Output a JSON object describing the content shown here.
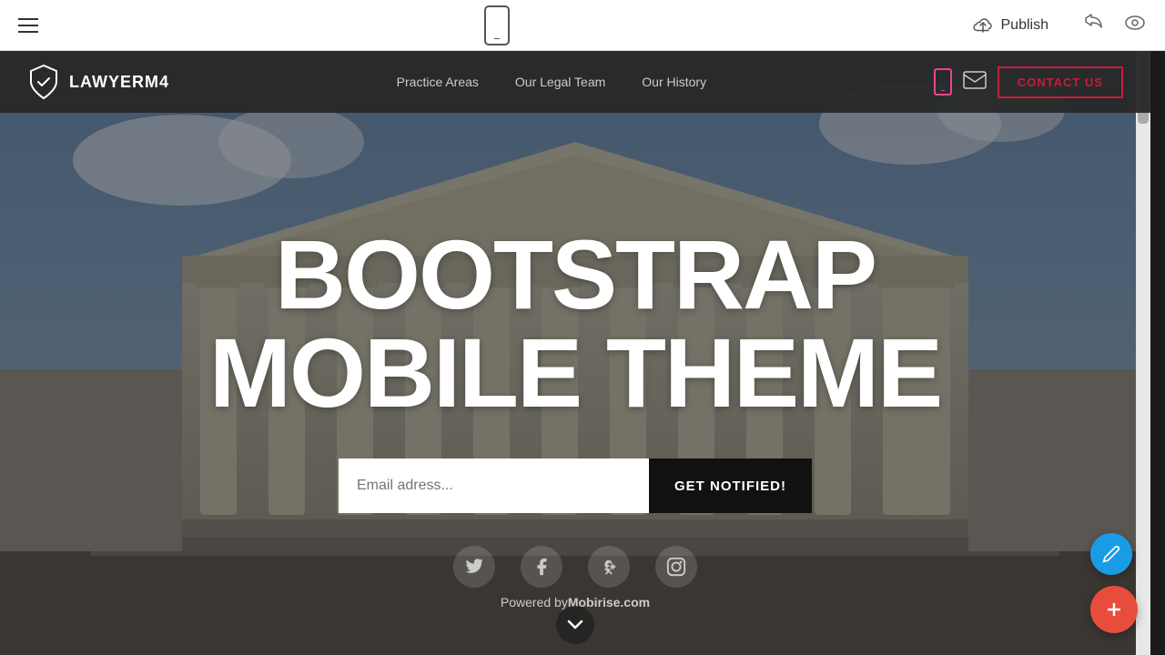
{
  "editor": {
    "publish_label": "Publish",
    "phone_preview_label": "Phone Preview"
  },
  "navbar": {
    "brand_name": "LAWYERM4",
    "nav_links": [
      {
        "label": "Practice Areas"
      },
      {
        "label": "Our Legal Team"
      },
      {
        "label": "Our History"
      }
    ],
    "contact_button": "CONTACT US"
  },
  "hero": {
    "title_line1": "BOOTSTRAP",
    "title_line2": "MOBILE THEME",
    "email_placeholder": "Email adress...",
    "notify_button": "GET NOTIFIED!",
    "powered_text": "Powered by",
    "powered_brand": "Mobirise.com",
    "social_icons": [
      "twitter",
      "facebook",
      "google-plus",
      "instagram"
    ]
  }
}
